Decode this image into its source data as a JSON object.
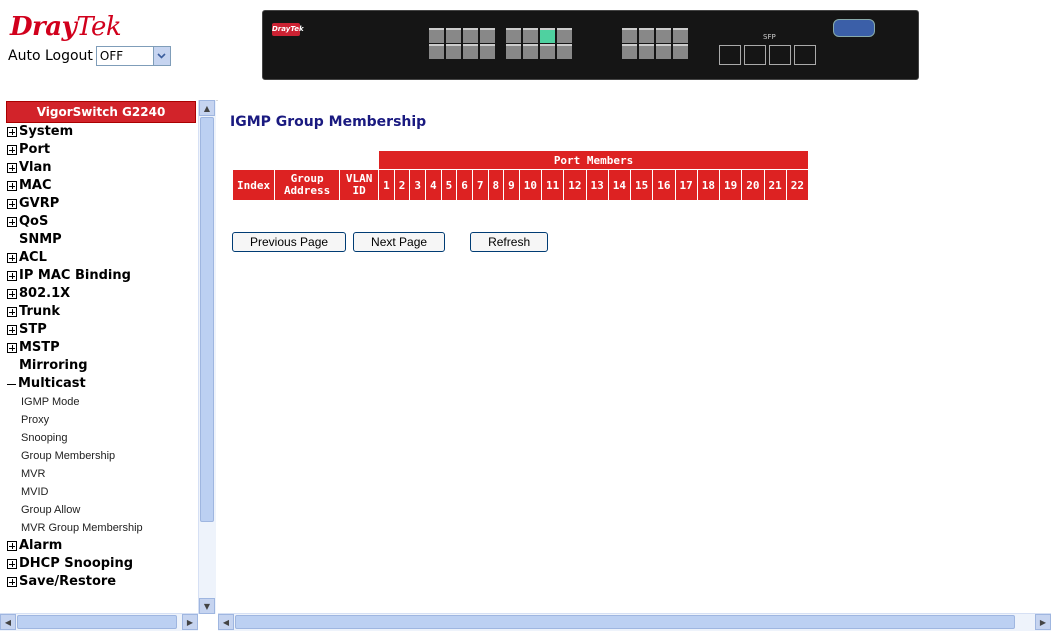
{
  "header": {
    "logo_main": "Dray",
    "logo_sub": "Tek",
    "auto_logout_label": "Auto Logout",
    "auto_logout_value": "OFF",
    "device_model": "VigorSwitch G2240"
  },
  "menu": {
    "title": "VigorSwitch G2240",
    "items": [
      {
        "label": "System",
        "icon": "plus"
      },
      {
        "label": "Port",
        "icon": "plus"
      },
      {
        "label": "Vlan",
        "icon": "plus"
      },
      {
        "label": "MAC",
        "icon": "plus"
      },
      {
        "label": "GVRP",
        "icon": "plus"
      },
      {
        "label": "QoS",
        "icon": "plus"
      },
      {
        "label": "SNMP",
        "icon": "none"
      },
      {
        "label": "ACL",
        "icon": "plus"
      },
      {
        "label": "IP MAC Binding",
        "icon": "plus"
      },
      {
        "label": "802.1X",
        "icon": "plus"
      },
      {
        "label": "Trunk",
        "icon": "plus"
      },
      {
        "label": "STP",
        "icon": "plus"
      },
      {
        "label": "MSTP",
        "icon": "plus"
      },
      {
        "label": "Mirroring",
        "icon": "none"
      },
      {
        "label": "Multicast",
        "icon": "minus"
      }
    ],
    "multicast_sub": [
      "IGMP Mode",
      "Proxy",
      "Snooping",
      "Group Membership",
      "MVR",
      "MVID",
      "Group Allow",
      "MVR Group Membership"
    ],
    "items_after": [
      {
        "label": "Alarm",
        "icon": "plus"
      },
      {
        "label": "DHCP Snooping",
        "icon": "plus"
      },
      {
        "label": "Save/Restore",
        "icon": "plus"
      }
    ]
  },
  "main": {
    "title": "IGMP Group Membership",
    "table": {
      "group_header": "Port Members",
      "columns": [
        "Index",
        "Group Address",
        "VLAN ID"
      ],
      "ports": [
        "1",
        "2",
        "3",
        "4",
        "5",
        "6",
        "7",
        "8",
        "9",
        "10",
        "11",
        "12",
        "13",
        "14",
        "15",
        "16",
        "17",
        "18",
        "19",
        "20",
        "21",
        "22"
      ]
    },
    "buttons": {
      "previous": "Previous Page",
      "next": "Next Page",
      "refresh": "Refresh"
    }
  },
  "colors": {
    "accent": "#dd2222",
    "title": "#1a1a80"
  }
}
